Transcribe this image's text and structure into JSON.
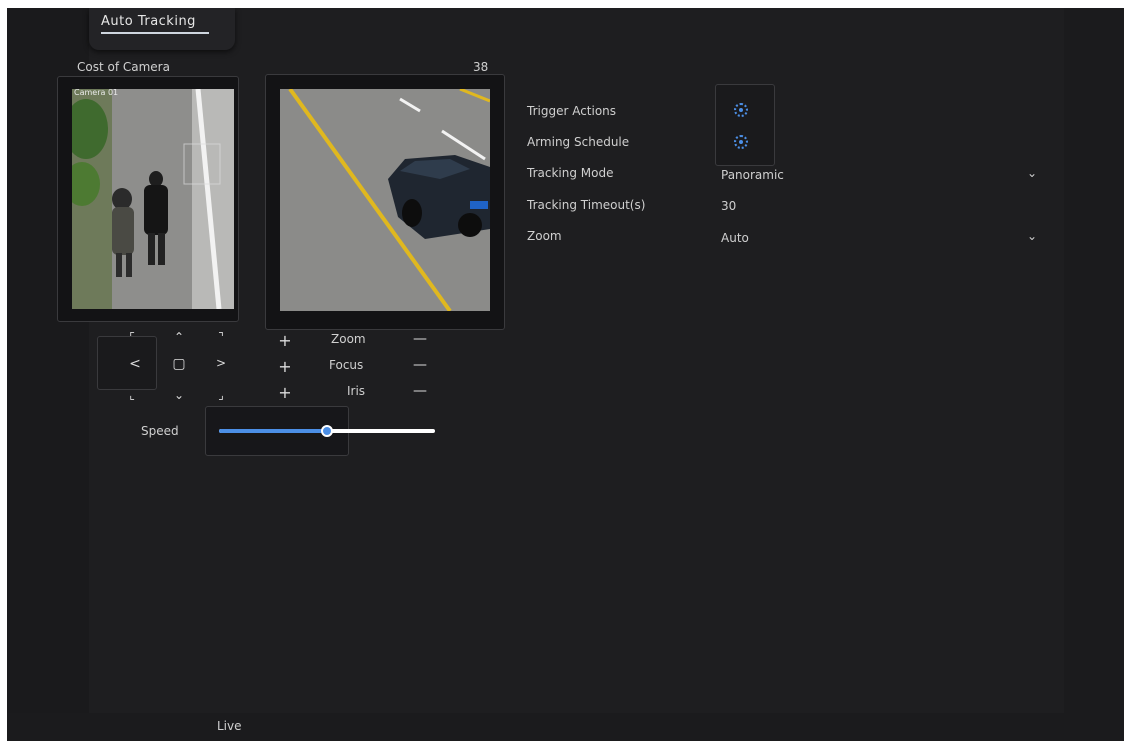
{
  "tab": {
    "label": "Auto Tracking"
  },
  "cameras": {
    "left_title": "Cost of Camera",
    "right_title": "38",
    "left_overlay": "Camera 01"
  },
  "settings": {
    "rows": [
      {
        "label": "Trigger Actions",
        "value": ""
      },
      {
        "label": "Arming Schedule",
        "value": ""
      },
      {
        "label": "Tracking Mode",
        "value": "Panoramic"
      },
      {
        "label": "Tracking Timeout(s)",
        "value": "30"
      },
      {
        "label": "Zoom",
        "value": "Auto"
      }
    ]
  },
  "ptz": {
    "zoom": "Zoom",
    "focus": "Focus",
    "iris": "Iris",
    "speed_label": "Speed",
    "speed_value": 0.5,
    "glyphs": {
      "ul": "⌜",
      "up": "⌃",
      "ur": "⌝",
      "left": "<",
      "center": "▢",
      "right": ">",
      "dl": "⌞",
      "down": "⌄",
      "dr": "⌟",
      "plus": "+",
      "minus": "—"
    }
  },
  "footer": {
    "label": "Live"
  },
  "colors": {
    "accent": "#4c8fe6",
    "bg": "#1e1e20"
  }
}
